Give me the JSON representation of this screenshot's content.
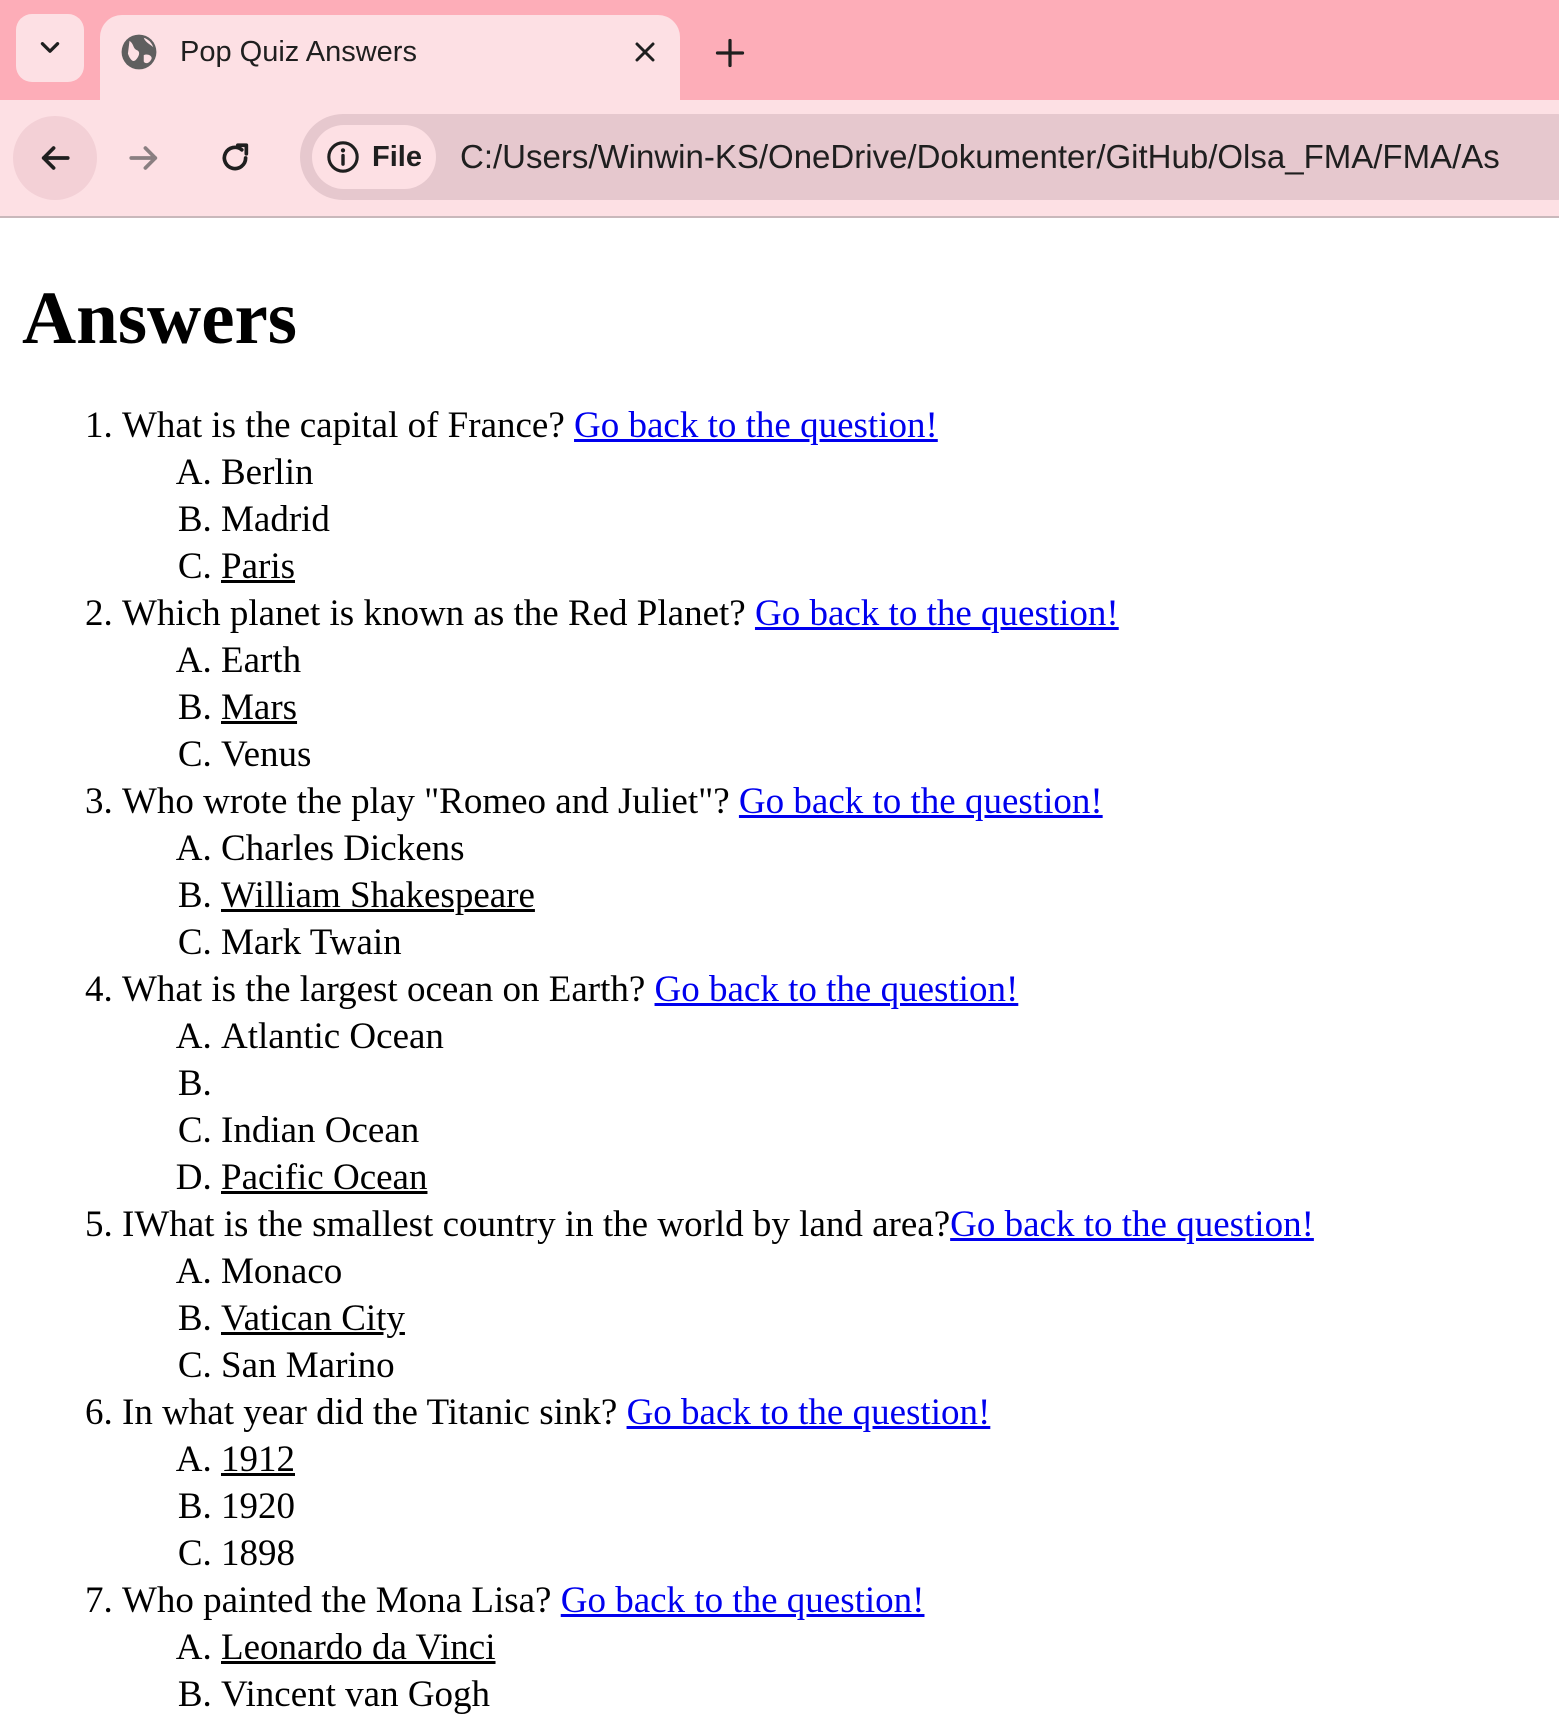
{
  "browser": {
    "tab_title": "Pop Quiz Answers",
    "address_chip": "File",
    "url": "C:/Users/Winwin-KS/OneDrive/Dokumenter/GitHub/Olsa_FMA/FMA/As"
  },
  "page": {
    "heading": "Answers",
    "questions": [
      {
        "text": "What is the capital of France? ",
        "link": "Go back to the question!",
        "options": [
          "Berlin",
          "Madrid",
          "Paris"
        ],
        "correct_option": "Paris"
      },
      {
        "text": "Which planet is known as the Red Planet? ",
        "link": "Go back to the question!",
        "options": [
          "Earth",
          "Mars",
          "Venus"
        ],
        "correct_option": "Mars"
      },
      {
        "text": "Who wrote the play \"Romeo and Juliet\"? ",
        "link": "Go back to the question!",
        "options": [
          "Charles Dickens",
          "William Shakespeare",
          "Mark Twain"
        ],
        "correct_option": "William Shakespeare"
      },
      {
        "text": "What is the largest ocean on Earth? ",
        "link": "Go back to the question!",
        "options": [
          "Atlantic Ocean",
          "",
          "Indian Ocean",
          "Pacific Ocean"
        ],
        "correct_option": "Pacific Ocean"
      },
      {
        "text": "IWhat is the smallest country in the world by land area?",
        "link": "Go back to the question!",
        "options": [
          "Monaco",
          "Vatican City",
          "San Marino"
        ],
        "correct_option": "Vatican City"
      },
      {
        "text": "In what year did the Titanic sink? ",
        "link": "Go back to the question!",
        "options": [
          "1912",
          "1920",
          "1898"
        ],
        "correct_option": "1912"
      },
      {
        "text": "Who painted the Mona Lisa? ",
        "link": "Go back to the question!",
        "options": [
          "Leonardo da Vinci",
          "Vincent van Gogh"
        ],
        "correct_option": "Leonardo da Vinci"
      }
    ]
  }
}
